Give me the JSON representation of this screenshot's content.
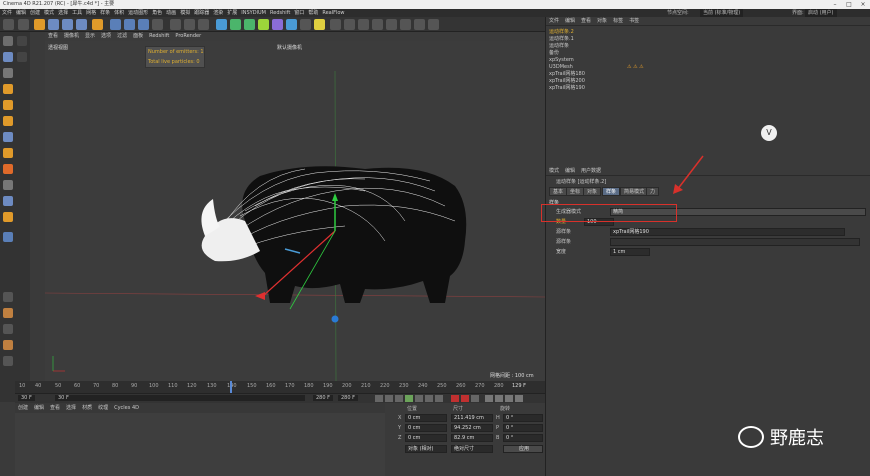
{
  "window": {
    "title": "Cinema 4D R21.207 (RC) - [犀牛.c4d *] - 主要"
  },
  "menubar": {
    "items": [
      "文件",
      "编辑",
      "创建",
      "模式",
      "选择",
      "工具",
      "网格",
      "样条",
      "体积",
      "运动图形",
      "角色",
      "动画",
      "模拟",
      "跟踪器",
      "渲染",
      "扩展",
      "INSYDIUM",
      "Redshift",
      "窗口",
      "帮助",
      "RealFlow"
    ],
    "interface_label": "节点空间:",
    "interface_value": "当前 (标准/物理)",
    "layout_label": "界面:",
    "layout_value": "启动 (用户)"
  },
  "viewport": {
    "menu": [
      "查看",
      "摄像机",
      "显示",
      "选项",
      "过滤",
      "面板",
      "Redshift",
      "ProRender"
    ],
    "view_name": "透视视图",
    "camera_label": "默认摄像机",
    "stats": {
      "emitters": "Number of emitters: 1",
      "particles": "Total live particles: 0"
    },
    "grid_spacing": "网格间距 : 100 cm"
  },
  "timeline": {
    "ticks": [
      "10",
      "40",
      "50",
      "60",
      "70",
      "80",
      "90",
      "100",
      "110",
      "120",
      "130",
      "140",
      "150",
      "160",
      "170",
      "180",
      "190",
      "200",
      "210",
      "220",
      "230",
      "240",
      "250",
      "260",
      "270",
      "280"
    ],
    "current_frame": "129 F",
    "start_frame": "30 F",
    "start_frame2": "30 F",
    "end_frame": "280 F",
    "end_frame2": "280 F"
  },
  "material": {
    "menu": [
      "创建",
      "编辑",
      "查看",
      "选择",
      "材质",
      "纹理",
      "Cycles 4D"
    ]
  },
  "coords": {
    "headers": {
      "position": "位置",
      "size": "尺寸",
      "rotation": "旋转"
    },
    "rows": [
      {
        "axis": "X",
        "pos": "0 cm",
        "size": "211.419 cm",
        "rot_axis": "H",
        "rot": "0 °"
      },
      {
        "axis": "Y",
        "pos": "0 cm",
        "size": "94.252 cm",
        "rot_axis": "P",
        "rot": "0 °"
      },
      {
        "axis": "Z",
        "pos": "0 cm",
        "size": "82.9 cm",
        "rot_axis": "B",
        "rot": "0 °"
      }
    ],
    "mode_select": "对象 (相对)",
    "size_select": "绝对尺寸",
    "apply_label": "应用"
  },
  "objects": {
    "menu": [
      "文件",
      "编辑",
      "查看",
      "对象",
      "标签",
      "书签"
    ],
    "items": [
      {
        "name": "运动样条.2",
        "color": "#e0b030",
        "tags": ""
      },
      {
        "name": "运动样条.1",
        "color": "#cfcfcf",
        "tags": ""
      },
      {
        "name": "运动样条",
        "color": "#cfcfcf",
        "tags": ""
      },
      {
        "name": "备份",
        "color": "#cfcfcf",
        "tags": ""
      },
      {
        "name": "xpSystem",
        "color": "#cfcfcf",
        "tags": ""
      },
      {
        "name": "U3DMesh",
        "color": "#cfcfcf",
        "tags": "⚠ ⚠ ⚠"
      },
      {
        "name": "xpTrail网格180",
        "color": "#cfcfcf",
        "tags": ""
      },
      {
        "name": "xpTrail网格200",
        "color": "#cfcfcf",
        "tags": ""
      },
      {
        "name": "xpTrail网格190",
        "color": "#cfcfcf",
        "tags": ""
      }
    ]
  },
  "attributes": {
    "menu": [
      "模式",
      "编辑",
      "用户数据"
    ],
    "object_title": "运动样条 [运动样条.2]",
    "tabs": [
      "基本",
      "坐标",
      "对象",
      "样条",
      "简易模式",
      "力"
    ],
    "active_tab": "样条",
    "section": "样条",
    "rows": [
      {
        "label": "生成器模式",
        "value": "精简"
      },
      {
        "label": "数量",
        "value": "100"
      },
      {
        "label": "源样条",
        "value": "xpTrail网格190"
      },
      {
        "label": "源样条",
        "value": ""
      },
      {
        "label": "宽度",
        "value": "1 cm"
      }
    ]
  },
  "watermark": {
    "text": "野鹿志"
  },
  "colors": {
    "accent": "#5a6c86",
    "highlight": "#d8312b",
    "stat_text": "#e0b030"
  }
}
